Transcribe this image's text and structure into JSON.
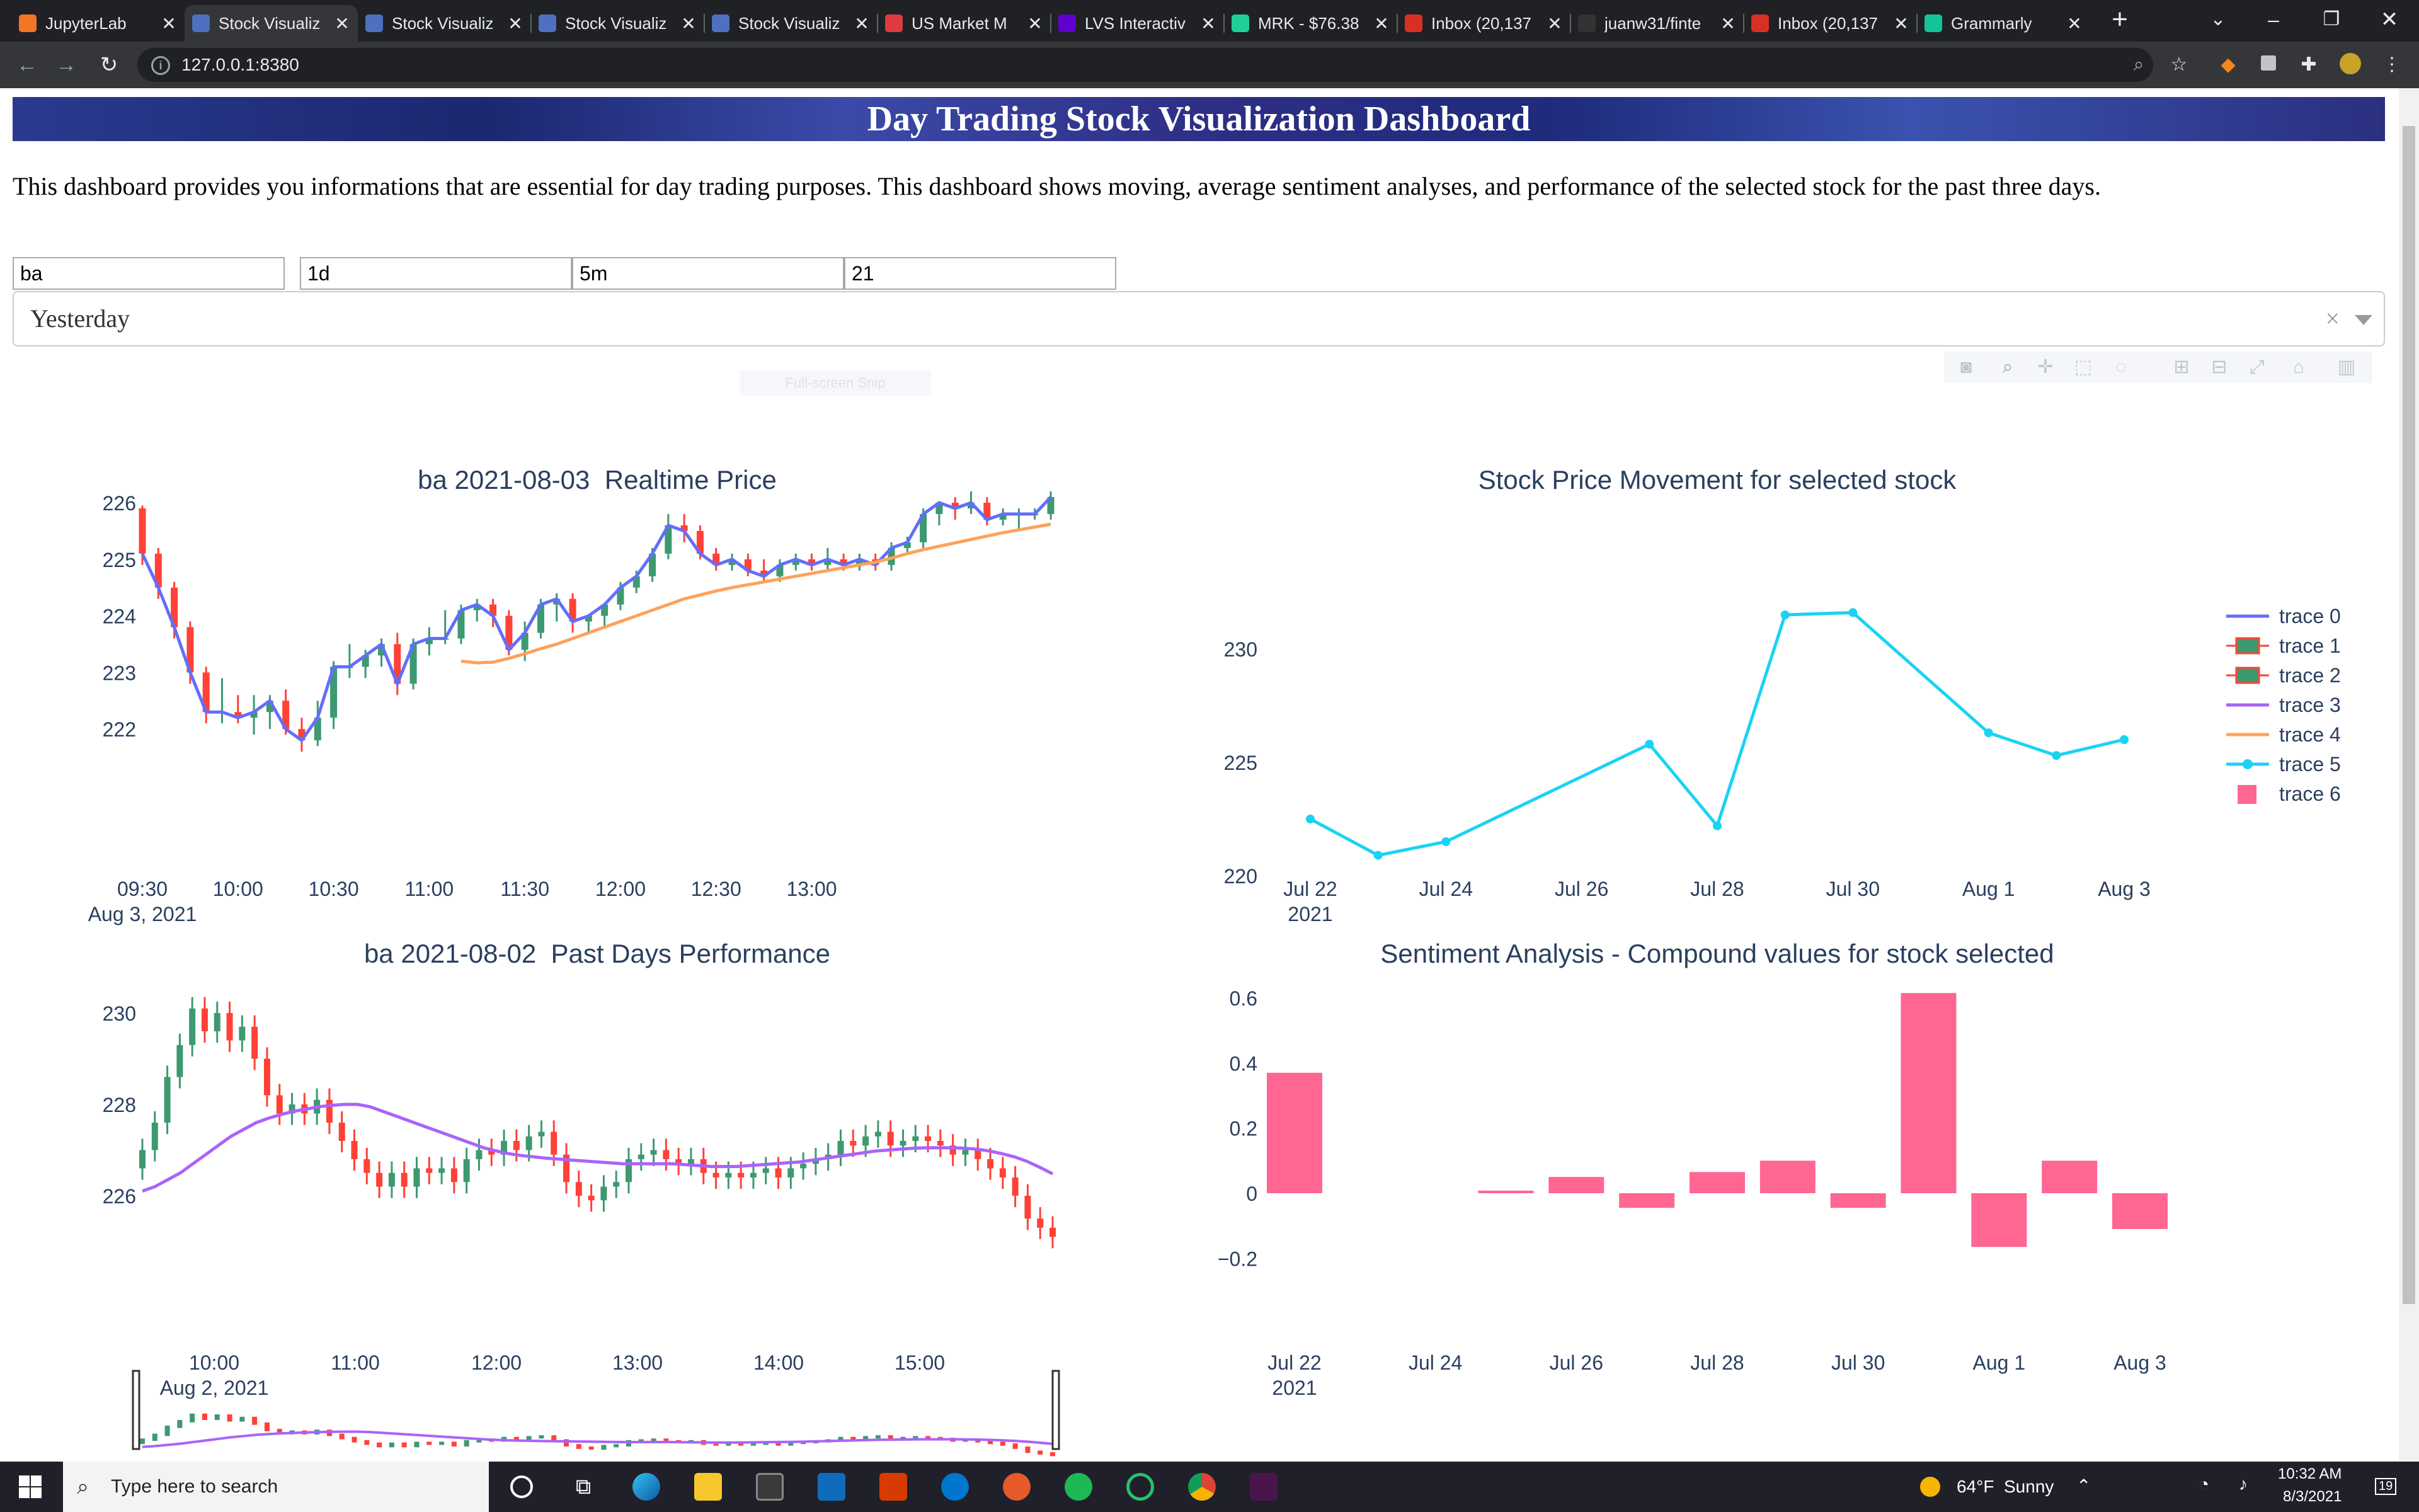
{
  "browser": {
    "tabs": [
      {
        "label": "JupyterLab",
        "icon": "jupyter-icon",
        "icon_color": "#f37626"
      },
      {
        "label": "Stock Visualiz",
        "icon": "dash-icon",
        "icon_color": "#4f6fbf",
        "active": true
      },
      {
        "label": "Stock Visualiz",
        "icon": "dash-icon",
        "icon_color": "#4f6fbf"
      },
      {
        "label": "Stock Visualiz",
        "icon": "dash-icon",
        "icon_color": "#4f6fbf"
      },
      {
        "label": "Stock Visualiz",
        "icon": "dash-icon",
        "icon_color": "#4f6fbf"
      },
      {
        "label": "US Market M",
        "icon": "cnbc-icon",
        "icon_color": "#e03a3e"
      },
      {
        "label": "LVS Interactiv",
        "icon": "yahoo-icon",
        "icon_color": "#6001d2"
      },
      {
        "label": "MRK - $76.38",
        "icon": "robinhood-icon",
        "icon_color": "#21ce99"
      },
      {
        "label": "Inbox (20,137",
        "icon": "gmail-icon",
        "icon_color": "#d93025"
      },
      {
        "label": "juanw31/finte",
        "icon": "github-icon",
        "icon_color": "#333333"
      },
      {
        "label": "Inbox (20,137",
        "icon": "gmail-icon",
        "icon_color": "#d93025"
      },
      {
        "label": "Grammarly",
        "icon": "grammarly-icon",
        "icon_color": "#15c39a"
      }
    ],
    "url": "127.0.0.1:8380"
  },
  "dashboard": {
    "title": "Day Trading Stock Visualization Dashboard",
    "description": "This dashboard provides you informations that are essential for day trading purposes. This dashboard shows moving, average sentiment analyses, and performance of the selected stock for the past three days.",
    "inputs": {
      "ticker": "ba",
      "period": "1d",
      "interval": "5m",
      "window": "21"
    },
    "day_select": {
      "value": "Yesterday",
      "clear": "×"
    },
    "fullscreen_hint": "Full-screen Snip"
  },
  "chart_data": [
    {
      "type": "candlestick",
      "title": "ba 2021-08-03  Realtime Price",
      "date_label": "Aug 3, 2021",
      "x_ticks": [
        "09:30",
        "10:00",
        "10:30",
        "11:00",
        "11:30",
        "12:00",
        "12:30",
        "13:00"
      ],
      "y_ticks": [
        222,
        223,
        224,
        225,
        226
      ],
      "ylim": [
        221.3,
        226.2
      ],
      "interval_minutes": 5,
      "ohlc": [
        [
          225.9,
          225.95,
          224.9,
          225.1
        ],
        [
          225.1,
          225.2,
          224.3,
          224.5
        ],
        [
          224.5,
          224.6,
          223.6,
          223.8
        ],
        [
          223.8,
          223.9,
          222.8,
          223.0
        ],
        [
          223.0,
          223.1,
          222.1,
          222.3
        ],
        [
          222.3,
          222.9,
          222.1,
          222.3
        ],
        [
          222.3,
          222.6,
          222.1,
          222.2
        ],
        [
          222.2,
          222.6,
          221.9,
          222.3
        ],
        [
          222.3,
          222.6,
          222.0,
          222.5
        ],
        [
          222.5,
          222.7,
          221.9,
          222.0
        ],
        [
          222.0,
          222.2,
          221.6,
          221.8
        ],
        [
          221.8,
          222.5,
          221.7,
          222.2
        ],
        [
          222.2,
          223.2,
          222.0,
          223.1
        ],
        [
          223.1,
          223.5,
          222.9,
          223.1
        ],
        [
          223.1,
          223.4,
          222.9,
          223.3
        ],
        [
          223.3,
          223.6,
          223.1,
          223.5
        ],
        [
          223.5,
          223.7,
          222.6,
          222.8
        ],
        [
          222.8,
          223.6,
          222.7,
          223.5
        ],
        [
          223.5,
          223.8,
          223.3,
          223.6
        ],
        [
          223.6,
          224.1,
          223.5,
          223.6
        ],
        [
          223.6,
          224.2,
          223.5,
          224.1
        ],
        [
          224.1,
          224.3,
          223.9,
          224.2
        ],
        [
          224.2,
          224.3,
          223.8,
          224.0
        ],
        [
          224.0,
          224.1,
          223.3,
          223.4
        ],
        [
          223.4,
          223.9,
          223.2,
          223.7
        ],
        [
          223.7,
          224.3,
          223.6,
          224.2
        ],
        [
          224.2,
          224.4,
          223.9,
          224.3
        ],
        [
          224.3,
          224.4,
          223.7,
          223.9
        ],
        [
          223.9,
          224.0,
          223.7,
          224.0
        ],
        [
          224.0,
          224.2,
          223.8,
          224.2
        ],
        [
          224.2,
          224.6,
          224.1,
          224.5
        ],
        [
          224.5,
          224.8,
          224.4,
          224.7
        ],
        [
          224.7,
          225.2,
          224.6,
          225.1
        ],
        [
          225.1,
          225.8,
          225.0,
          225.6
        ],
        [
          225.6,
          225.8,
          225.3,
          225.5
        ],
        [
          225.5,
          225.6,
          225.0,
          225.1
        ],
        [
          225.1,
          225.2,
          224.8,
          224.9
        ],
        [
          224.9,
          225.1,
          224.8,
          225.0
        ],
        [
          225.0,
          225.1,
          224.7,
          224.8
        ],
        [
          224.8,
          225.0,
          224.6,
          224.7
        ],
        [
          224.7,
          225.0,
          224.6,
          224.9
        ],
        [
          224.9,
          225.1,
          224.8,
          225.0
        ],
        [
          225.0,
          225.1,
          224.8,
          224.9
        ],
        [
          224.9,
          225.2,
          224.8,
          225.0
        ],
        [
          225.0,
          225.1,
          224.8,
          224.9
        ],
        [
          224.9,
          225.1,
          224.8,
          225.0
        ],
        [
          225.0,
          225.1,
          224.8,
          224.9
        ],
        [
          224.9,
          225.3,
          224.8,
          225.2
        ],
        [
          225.2,
          225.4,
          225.1,
          225.3
        ],
        [
          225.3,
          225.9,
          225.2,
          225.8
        ],
        [
          225.8,
          226.0,
          225.6,
          226.0
        ],
        [
          226.0,
          226.1,
          225.7,
          225.9
        ],
        [
          225.9,
          226.2,
          225.8,
          226.0
        ],
        [
          226.0,
          226.1,
          225.6,
          225.7
        ],
        [
          225.7,
          225.9,
          225.6,
          225.8
        ],
        [
          225.8,
          225.9,
          225.5,
          225.8
        ],
        [
          225.8,
          225.9,
          225.7,
          225.8
        ],
        [
          225.8,
          226.2,
          225.7,
          226.1
        ]
      ],
      "ma_start_index": 20,
      "ma": [
        223.2,
        223.17,
        223.18,
        223.25,
        223.33,
        223.42,
        223.5,
        223.6,
        223.7,
        223.8,
        223.9,
        224.0,
        224.1,
        224.2,
        224.3,
        224.37,
        224.44,
        224.5,
        224.55,
        224.6,
        224.65,
        224.7,
        224.75,
        224.8,
        224.85,
        224.9,
        224.95,
        225.02,
        225.1,
        225.17,
        225.23,
        225.29,
        225.35,
        225.41,
        225.47,
        225.52,
        225.57,
        225.62
      ],
      "colors": {
        "up": "#3d9970",
        "down": "#ff4136",
        "close_line": "#636efa",
        "ma": "#ffa15a"
      }
    },
    {
      "type": "line",
      "title": "Stock Price Movement for selected stock",
      "x": [
        "2021-07-22",
        "2021-07-23",
        "2021-07-24",
        "2021-07-27",
        "2021-07-28",
        "2021-07-29",
        "2021-07-30",
        "2021-08-01",
        "2021-08-02",
        "2021-08-03"
      ],
      "y": [
        222.5,
        220.9,
        221.5,
        225.8,
        222.2,
        231.5,
        231.6,
        226.3,
        225.3,
        226.0
      ],
      "x_ticks": [
        "Jul 22",
        "Jul 24",
        "Jul 26",
        "Jul 28",
        "Jul 30",
        "Aug 1",
        "Aug 3"
      ],
      "x_year": "2021",
      "y_ticks": [
        220,
        225,
        230
      ],
      "ylim": [
        219.5,
        233
      ],
      "legend": [
        "trace 0",
        "trace 1",
        "trace 2",
        "trace 3",
        "trace 4",
        "trace 5",
        "trace 6"
      ],
      "legend_position": "right",
      "colors": {
        "line": "#19d3f3"
      }
    },
    {
      "type": "candlestick",
      "title": "ba 2021-08-02  Past Days Performance",
      "date_label": "Aug 2, 2021",
      "x_ticks": [
        "10:00",
        "11:00",
        "12:00",
        "13:00",
        "14:00",
        "15:00"
      ],
      "y_ticks": [
        226,
        228,
        230
      ],
      "ylim": [
        224.9,
        230.7
      ],
      "interval_minutes": 5,
      "close": [
        227.0,
        227.6,
        228.6,
        229.3,
        230.1,
        229.6,
        230.0,
        229.4,
        229.7,
        229.0,
        228.2,
        227.8,
        228.0,
        227.8,
        228.1,
        227.6,
        227.2,
        226.8,
        226.5,
        226.2,
        226.5,
        226.2,
        226.6,
        226.5,
        226.6,
        226.3,
        226.8,
        227.0,
        226.9,
        227.2,
        227.0,
        227.3,
        227.4,
        226.9,
        226.3,
        226.0,
        225.9,
        226.2,
        226.3,
        226.8,
        226.9,
        227.0,
        226.8,
        226.7,
        226.8,
        226.5,
        226.4,
        226.5,
        226.4,
        226.5,
        226.6,
        226.4,
        226.6,
        226.7,
        226.8,
        226.9,
        227.2,
        227.1,
        227.3,
        227.4,
        227.1,
        227.2,
        227.3,
        227.2,
        227.1,
        226.9,
        227.0,
        226.8,
        226.6,
        226.4,
        226.0,
        225.5,
        225.3,
        225.1
      ],
      "ma": [
        226.1,
        226.2,
        226.35,
        226.5,
        226.7,
        226.9,
        227.1,
        227.3,
        227.45,
        227.6,
        227.7,
        227.78,
        227.85,
        227.9,
        227.95,
        227.98,
        228.0,
        228.0,
        227.95,
        227.85,
        227.75,
        227.65,
        227.55,
        227.45,
        227.35,
        227.25,
        227.15,
        227.05,
        226.98,
        226.92,
        226.88,
        226.85,
        226.82,
        226.8,
        226.78,
        226.76,
        226.74,
        226.72,
        226.7,
        226.7,
        226.7,
        226.7,
        226.7,
        226.68,
        226.66,
        226.64,
        226.64,
        226.64,
        226.66,
        226.68,
        226.7,
        226.72,
        226.74,
        226.78,
        226.82,
        226.86,
        226.9,
        226.94,
        226.98,
        227.0,
        227.02,
        227.04,
        227.05,
        227.05,
        227.05,
        227.04,
        227.02,
        226.98,
        226.92,
        226.85,
        226.75,
        226.62,
        226.48
      ],
      "colors": {
        "up": "#3d9970",
        "down": "#ff4136",
        "ma": "#ab63fa"
      }
    },
    {
      "type": "bar",
      "title": "Sentiment Analysis - Compound values for stock selected",
      "x": [
        "2021-07-22",
        "2021-07-25",
        "2021-07-26",
        "2021-07-27",
        "2021-07-28",
        "2021-07-29",
        "2021-07-30",
        "2021-07-31",
        "2021-08-01",
        "2021-08-02",
        "2021-08-03"
      ],
      "values": [
        0.37,
        0.008,
        0.05,
        -0.045,
        0.065,
        0.1,
        -0.045,
        0.615,
        -0.165,
        0.1,
        -0.11
      ],
      "x_ticks": [
        "Jul 22",
        "Jul 24",
        "Jul 26",
        "Jul 28",
        "Jul 30",
        "Aug 1",
        "Aug 3"
      ],
      "x_year": "2021",
      "y_ticks": [
        "−0.2",
        "0",
        "0.2",
        "0.4",
        "0.6"
      ],
      "ylim": [
        -0.2,
        0.62
      ],
      "colors": {
        "bar": "#ff6692"
      }
    }
  ],
  "taskbar": {
    "search_placeholder": "Type here to search",
    "weather": "64°F  Sunny",
    "time": "10:32 AM",
    "date": "8/3/2021",
    "notifications": "19"
  }
}
